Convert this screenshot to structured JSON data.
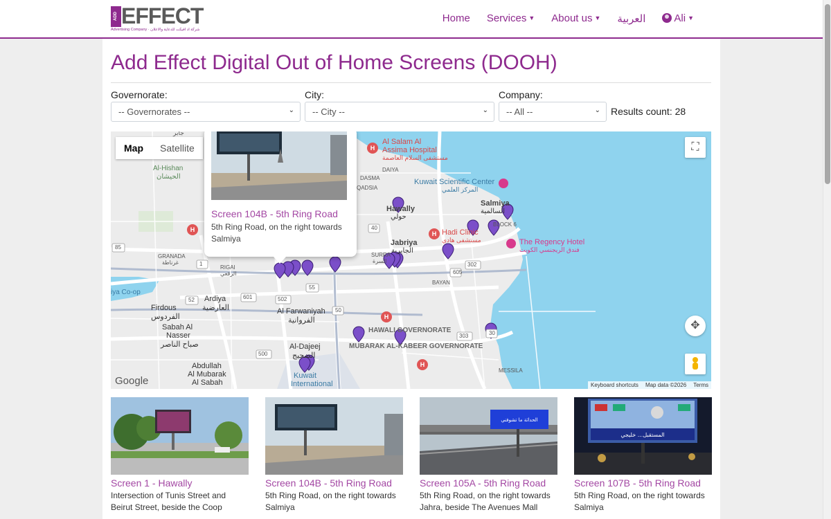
{
  "brand": {
    "logo_box": "ADD",
    "logo_word": "EFFECT",
    "logo_tagline": "Advertising Company · شركة اد افيكت للدعاية والاعلان"
  },
  "nav": {
    "home": "Home",
    "services": "Services",
    "about": "About us",
    "arabic": "العربية",
    "user": "Ali"
  },
  "page": {
    "title": "Add Effect Digital Out of Home Screens (DOOH)"
  },
  "filters": {
    "governorate_label": "Governorate:",
    "governorate_value": "-- Governorates --",
    "city_label": "City:",
    "city_value": "-- City --",
    "company_label": "Company:",
    "company_value": "-- All --",
    "results": "Results count: 28"
  },
  "map": {
    "type_map": "Map",
    "type_satellite": "Satellite",
    "google": "Google",
    "shortcuts": "Keyboard shortcuts",
    "mapdata": "Map data ©2026",
    "terms": "Terms",
    "labels": {
      "alsalam": "Al Salam Al",
      "assima": "Assima Hospital",
      "assima_ar": "مستشفى السلام العاصمة",
      "scicenter": "Kuwait Scientific Center",
      "scicenter_ar": "المركز العلمي",
      "hawally": "Hawally",
      "hawally_ar": "حولي",
      "salmiya": "Salmiya",
      "salmiya_ar": "السالمية",
      "hadi": "Hadi Clinic",
      "hadi_ar": "مستشفى هادي",
      "regency": "The Regency Hotel",
      "regency_ar": "فندق الريجنسي الكويت",
      "jabriya": "Jabriya",
      "jabriya_ar": "الجابرية",
      "alhishan": "Al-Hishan",
      "alhishan_ar": "الحيشان",
      "ardiya": "Ardiya",
      "ardiya_ar": "العارضية",
      "firdous": "Firdous",
      "firdous_ar": "الفردوس",
      "sabah1": "Sabah Al",
      "sabah2": "Nasser",
      "sabah_ar": "صباح الناصر",
      "farwaniyah": "Al Farwaniyah",
      "farwaniyah_ar": "الفروانية",
      "dajeej": "Al-Dajeej",
      "dajeej_ar": "الضجيج",
      "abdullah1": "Abdullah",
      "abdullah2": "Al Mubarak",
      "abdullah3": "Al Sabah",
      "kuwait1": "Kuwait",
      "kuwait2": "International",
      "hawalli_gov": "HAWALI GOVERNORATE",
      "mubarak_gov": "MUBARAK AL-KABEER GOVERNORATE",
      "rigai": "RIGAI",
      "rigai_ar": "الرقعي",
      "granada": "GRANADA",
      "granada_ar": "غرناطة",
      "surra": "SURRA",
      "surra_ar": "السرة",
      "bayan": "BAYAN",
      "messila": "MESSILA",
      "daiya": "DAIYA",
      "dasma": "DASMA",
      "qadsia": "QADSIA",
      "block6": "BLOCK 6",
      "iya_coop": "iya Co-op",
      "jaber": "جابر",
      "r85": "85",
      "r40": "40",
      "r55": "55",
      "r601": "601",
      "r52": "52",
      "r502": "502",
      "r50": "50",
      "r302": "302",
      "r30": "30",
      "r303": "303",
      "r500": "500",
      "r605": "605",
      "r1": "1"
    },
    "popup": {
      "title": "Screen 104B - 5th Ring Road",
      "desc": "5th Ring Road, on the right towards Salmiya"
    }
  },
  "cards": [
    {
      "title": "Screen 1 - Hawally",
      "desc": "Intersection of Tunis Street and Beirut Street, beside the Coop"
    },
    {
      "title": "Screen 104B - 5th Ring Road",
      "desc": "5th Ring Road, on the right towards Salmiya"
    },
    {
      "title": "Screen 105A - 5th Ring Road",
      "desc": "5th Ring Road, on the right towards Jahra, beside The Avenues Mall"
    },
    {
      "title": "Screen 107B - 5th Ring Road",
      "desc": "5th Ring Road, on the right towards Salmiya"
    }
  ],
  "card_texts": {
    "c1_billboard": "",
    "c3_billboard": "الحداثة ما تشوفني",
    "c4_billboard": "المستقبل... خليجي"
  },
  "colors": {
    "accent": "#8e2a8e",
    "marker": "#7b4fc9",
    "water": "#8fd3ee"
  }
}
